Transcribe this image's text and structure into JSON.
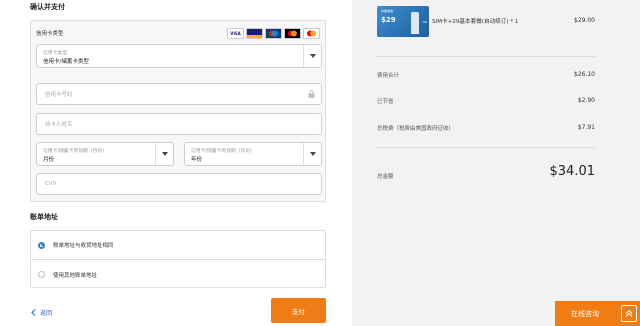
{
  "payment": {
    "section_title": "确认并支付",
    "card_type_label": "信用卡类型",
    "card_type_small": "信用卡类型",
    "card_type_value": "信用卡/储蓄卡类型",
    "card_number_placeholder": "信用卡号码",
    "cardholder_placeholder": "持卡人姓名",
    "month_small": "信用卡/储蓄卡有效期（月份）",
    "month_value": "月份",
    "year_small": "信用卡/储蓄卡有效期（年份）",
    "year_value": "年份",
    "cvv_placeholder": "CVV",
    "card_logos": [
      "VISA",
      "Visa Electron",
      "Maestro",
      "MasterCard",
      "MasterCard"
    ]
  },
  "billing": {
    "section_title": "账单地址",
    "options": [
      {
        "label": "账单地址与收货地址相同",
        "selected": true
      },
      {
        "label": "使用其他账单地址",
        "selected": false
      }
    ]
  },
  "actions": {
    "back_label": "返回",
    "pay_label": "支付"
  },
  "product": {
    "image_price": "$29",
    "name": "SIM卡+29基本套餐(自动续订) * 1",
    "price": "$29.00"
  },
  "summary": {
    "subtotal_label": "费用合计",
    "subtotal_value": "$26.10",
    "saved_label": "已节省",
    "saved_value": "$2.90",
    "tax_label": "总税费（税费由美国政府征收）",
    "tax_value": "$7.91",
    "total_label": "总金额",
    "total_value": "$34.01"
  },
  "chat": {
    "label": "在线咨询"
  },
  "colors": {
    "accent_orange": "#f07c14",
    "link_blue": "#2a68c8",
    "radio_blue": "#3a7bd5",
    "right_panel_bg": "#f2f2f2"
  }
}
